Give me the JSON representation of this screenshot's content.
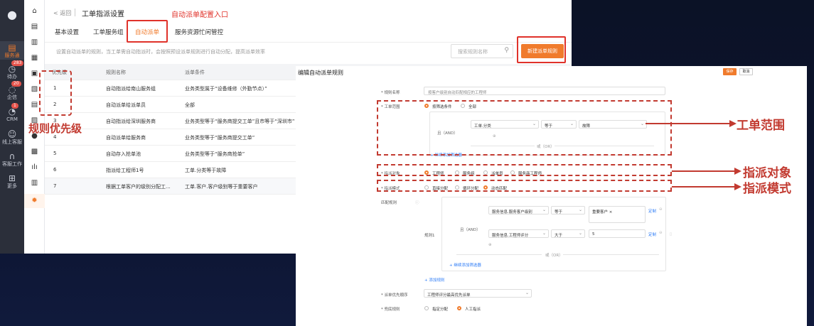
{
  "left_rail": {
    "items": [
      {
        "label": ""
      },
      {
        "label": "服务通"
      },
      {
        "label": "待办",
        "badge": "283"
      },
      {
        "label": "企信",
        "badge": "20"
      },
      {
        "label": "CRM",
        "badge": "1"
      },
      {
        "label": "线上客服"
      },
      {
        "label": "客服工作"
      },
      {
        "label": "更多"
      }
    ]
  },
  "header": {
    "back": "< 返回",
    "title": "工单指派设置",
    "annotation_entry": "自动派单配置入口"
  },
  "tabs": [
    "基本设置",
    "工单服务组",
    "自动派单",
    "服务资源忙闲管控"
  ],
  "description": "设置自动派单的规则，当工单需自动指派时，会按照预设派单规则进行自动分配，提高派单效率",
  "search": {
    "placeholder": "搜索规则名称"
  },
  "new_rule_button": "新建派单规则",
  "table": {
    "headers": [
      "优先级",
      "规则名称",
      "派单条件"
    ],
    "rows": [
      {
        "priority": "1",
        "name": "自动指派给南山服务组",
        "condition": "业务类型属于“设备维修（外勤节点）”"
      },
      {
        "priority": "2",
        "name": "自动派单给派单员",
        "condition": "全部"
      },
      {
        "priority": "3",
        "name": "自动指派给深圳服务商",
        "condition": "业务类型等于“服务商提交工单”且市等于“深圳市”"
      },
      {
        "priority": "4",
        "name": "自动派单给服务商",
        "condition": "业务类型等于“服务商提交工单”"
      },
      {
        "priority": "5",
        "name": "自动存入抢单池",
        "condition": "业务类型等于“服务商抢单”"
      },
      {
        "priority": "6",
        "name": "指派给工程师1号",
        "condition": "工单.分类等于故障"
      },
      {
        "priority": "7",
        "name": "根据工单客户的级别分配工...",
        "condition": "工单.客户.客户级别等于重要客户"
      }
    ]
  },
  "annotation_priority": "规则优先级",
  "edit": {
    "title": "编辑自动派单规则",
    "save": "保存",
    "cancel": "取消",
    "rule_name_label": "* 规则名称",
    "rule_name_value": "按客户级别自动匹配相应的工程师",
    "scope_label": "* 工单范围",
    "scope_opt1": "按筛选条件",
    "scope_opt2": "全部",
    "and_label": "且（AND）",
    "scope_field": "工单.分类",
    "scope_op": "等于",
    "scope_value": "故障",
    "add_filter": "+ 继续添加筛选器",
    "or_label": "或（OR）",
    "assign_target_label": "* 指派对象",
    "assign_targets": [
      "工程师",
      "服务组",
      "派单员",
      "服务商工程师"
    ],
    "assign_mode_label": "* 指派模式",
    "assign_modes": [
      "直接分配",
      "循环分配",
      "动态匹配"
    ],
    "match_rule_label": "匹配规则",
    "rule1_label": "规则1",
    "cond1_field": "服务信息.服务客户级别",
    "cond1_op": "等于",
    "cond1_value": "重要客户 ×",
    "cond2_field": "服务信息.工程师评分",
    "cond2_op": "大于",
    "cond2_value": "5",
    "custom_link": "定制",
    "add_filter2": "+ 继续添加筛选器",
    "add_rule": "+ 添加规则",
    "priority_order_label": "* 派单优先顺序",
    "priority_order_value": "工程师评分最高优先派单",
    "fallback_label": "* 兜底规则",
    "fallback_opts": [
      "指定分配",
      "人工指派"
    ]
  },
  "annotations": {
    "scope": "工单范围",
    "target": "指派对象",
    "mode": "指派模式"
  },
  "colors": {
    "accent": "#f07b2c",
    "annotation_red": "#c23a30",
    "highlight_red": "#e0322a"
  }
}
